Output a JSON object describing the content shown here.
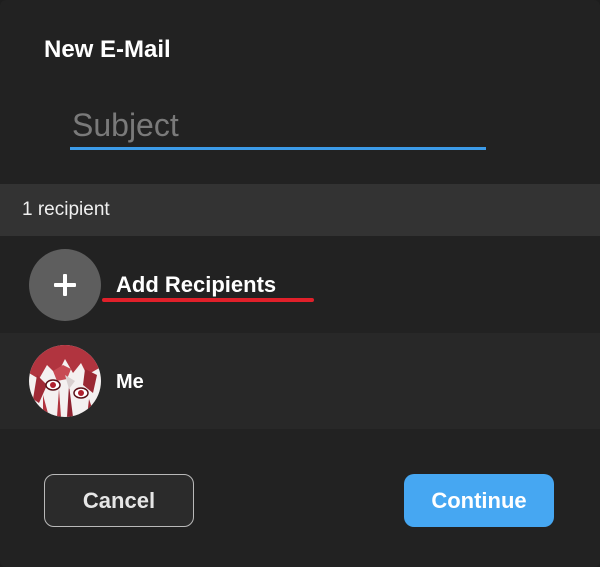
{
  "dialog": {
    "title": "New E-Mail"
  },
  "subject": {
    "placeholder": "Subject",
    "value": ""
  },
  "recipients": {
    "count_label": "1 recipient",
    "add_label": "Add Recipients",
    "add_icon": "plus-icon",
    "items": [
      {
        "name": "Me",
        "avatar": "anime-avatar"
      }
    ]
  },
  "actions": {
    "cancel_label": "Cancel",
    "continue_label": "Continue"
  },
  "colors": {
    "background": "#222222",
    "accent_blue": "#46a7f2",
    "subject_underline": "#3c9be8",
    "highlight_red": "#e0202a"
  }
}
